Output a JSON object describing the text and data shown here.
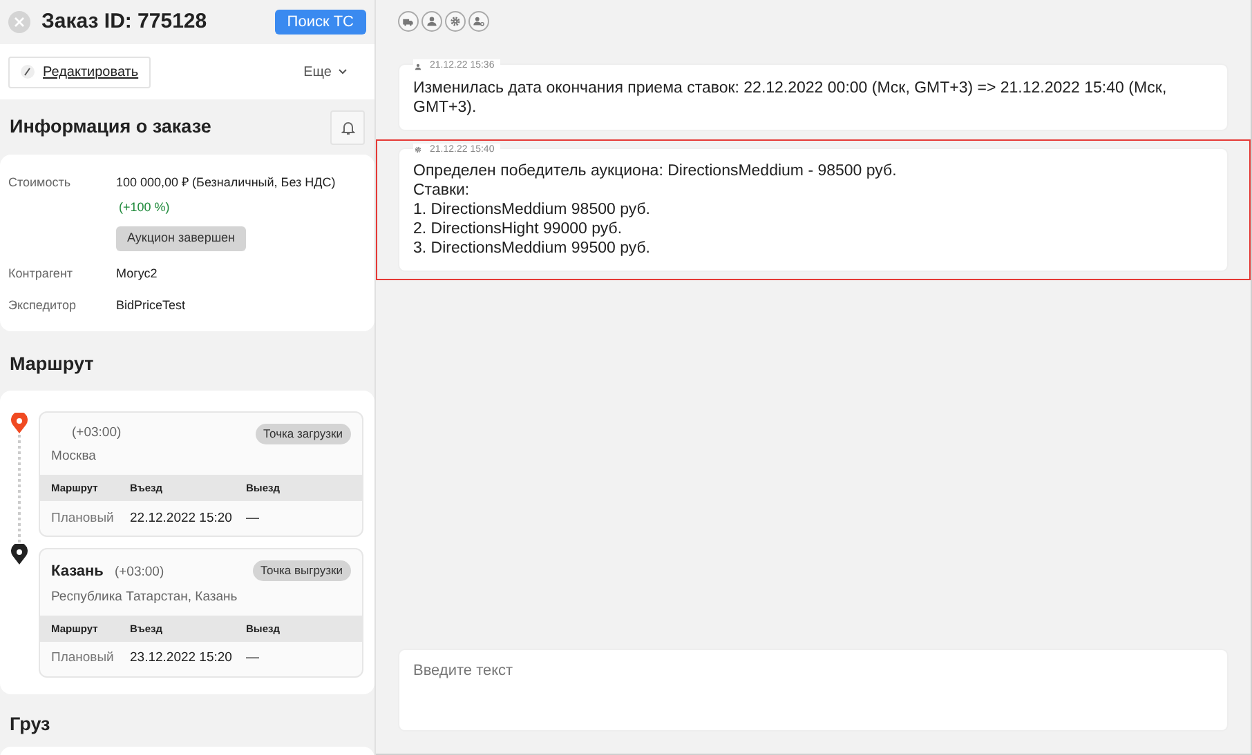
{
  "header": {
    "title": "Заказ ID: 775128",
    "search_button": "Поиск ТС"
  },
  "toolbar": {
    "edit": "Редактировать",
    "more": "Еще"
  },
  "order_info": {
    "title": "Информация о заказе",
    "rows": [
      {
        "label": "Стоимость",
        "value": "100 000,00 ₽ (Безналичный, Без НДС)",
        "note": "(+100 %)",
        "badge": "Аукцион завершен"
      },
      {
        "label": "Контрагент",
        "value": "Могус2"
      },
      {
        "label": "Экспедитор",
        "value": "BidPriceTest"
      }
    ]
  },
  "route": {
    "title": "Маршрут",
    "stops": [
      {
        "kind": "loading",
        "tz": "(+03:00)",
        "address": "Москва",
        "badge": "Точка загрузки",
        "columns": [
          "Маршрут",
          "Въезд",
          "Выезд"
        ],
        "row": [
          "Плановый",
          "22.12.2022 15:20",
          "—"
        ]
      },
      {
        "kind": "unloading",
        "city": "Казань",
        "tz": "(+03:00)",
        "address": "Республика Татарстан, Казань",
        "badge": "Точка выгрузки",
        "columns": [
          "Маршрут",
          "Въезд",
          "Выезд"
        ],
        "row": [
          "Плановый",
          "23.12.2022 15:20",
          "—"
        ]
      }
    ]
  },
  "cargo": {
    "title": "Груз"
  },
  "filters": [
    {
      "kind": "truck"
    },
    {
      "kind": "person"
    },
    {
      "kind": "gear"
    },
    {
      "kind": "person-gear"
    }
  ],
  "messages": [
    {
      "kind": "person",
      "time": "21.12.22 15:36",
      "highlighted": false,
      "lines": [
        "Изменилась дата окончания приема ставок: 22.12.2022 00:00 (Мск, GMT+3) => 21.12.2022 15:40 (Мск, GMT+3)."
      ]
    },
    {
      "kind": "gear",
      "time": "21.12.22 15:40",
      "highlighted": true,
      "lines": [
        "Определен победитель аукциона: DirectionsMeddium - 98500 руб.",
        "Ставки:",
        "1. DirectionsMeddium 98500 руб.",
        "2. DirectionsHight 99000 руб.",
        "3. DirectionsMeddium 99500 руб."
      ]
    }
  ],
  "composer": {
    "placeholder": "Введите текст"
  }
}
